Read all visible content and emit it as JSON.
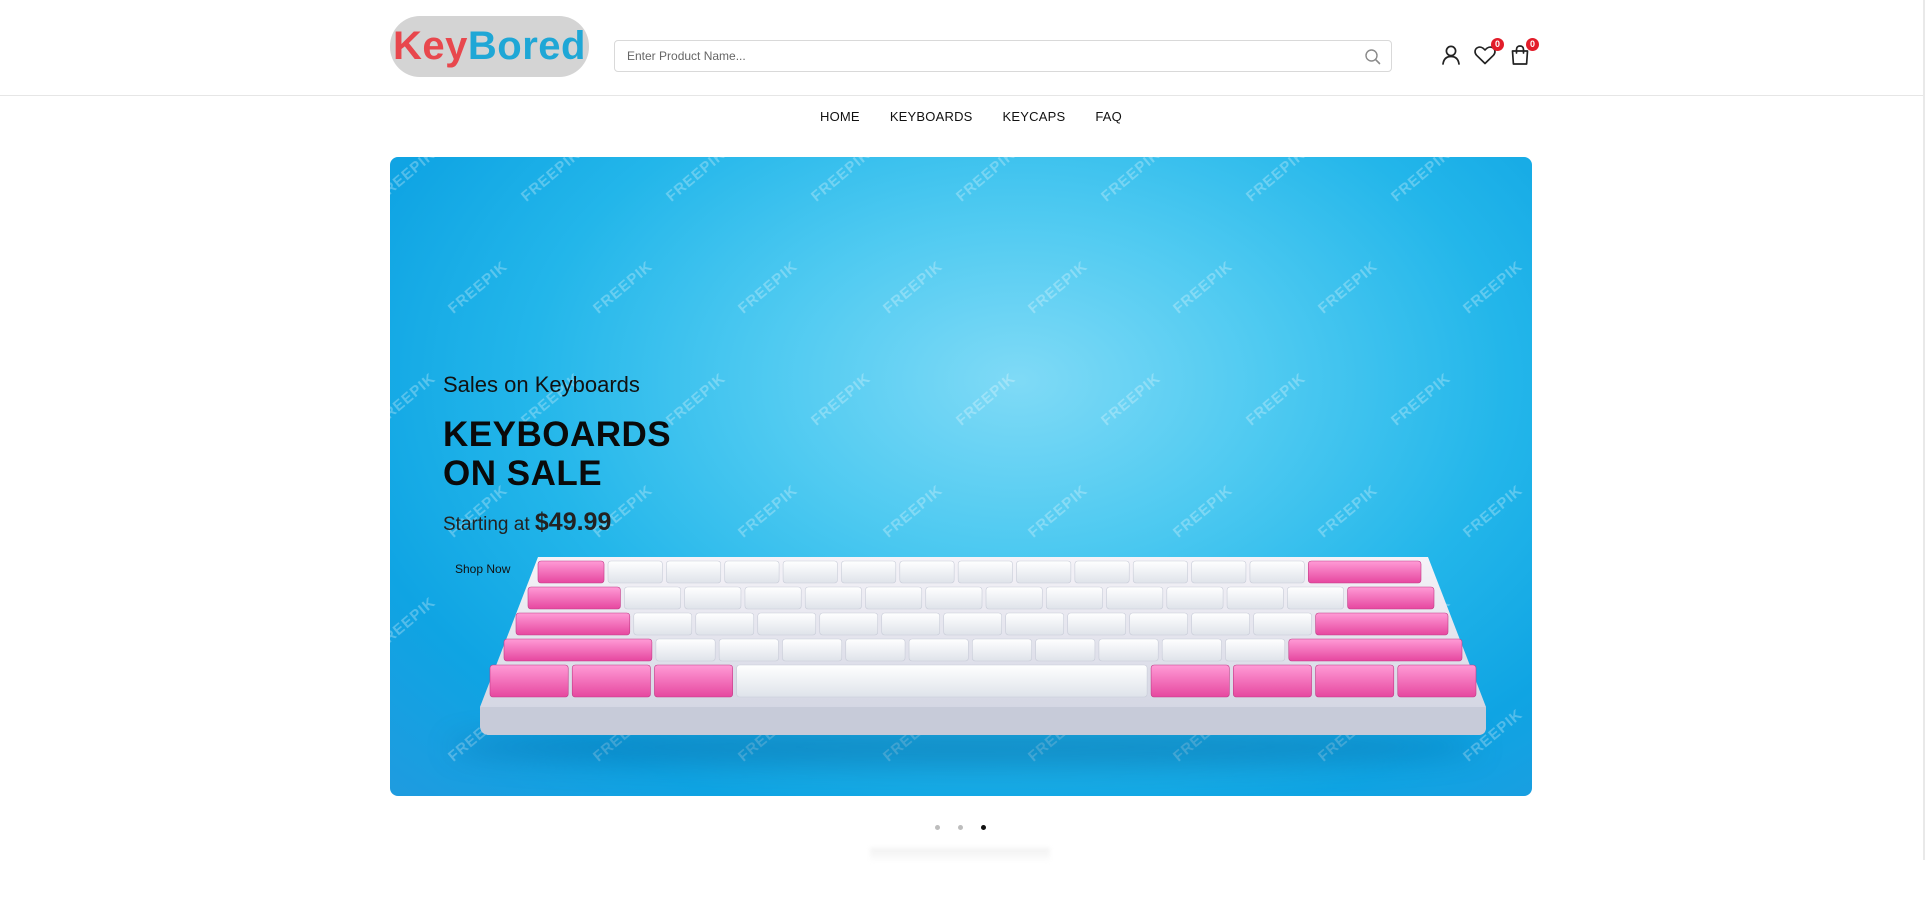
{
  "brand": {
    "part1": "Key",
    "part2": "Bored"
  },
  "search": {
    "placeholder": "Enter Product Name...",
    "value": ""
  },
  "header_icons": {
    "account": "user-icon",
    "wishlist": {
      "icon": "heart-icon",
      "count": "0"
    },
    "cart": {
      "icon": "shopping-bag-icon",
      "count": "0"
    }
  },
  "nav": {
    "items": [
      {
        "label": "HOME"
      },
      {
        "label": "KEYBOARDS"
      },
      {
        "label": "KEYCAPS"
      },
      {
        "label": "FAQ"
      }
    ]
  },
  "hero": {
    "subtitle": "Sales on Keyboards",
    "title_line1": "KEYBOARDS",
    "title_line2": "ON SALE",
    "price_prefix": "Starting at",
    "price": "$49.99",
    "cta": "Shop Now",
    "watermark": "FREEPIK"
  },
  "carousel": {
    "slides": 3,
    "active_index": 2
  },
  "colors": {
    "brand_red": "#e8474d",
    "brand_blue": "#1fa7d6",
    "badge": "#e21d2a",
    "hero_bg": "#23b6ea",
    "keycap_pink": "#f07cc4",
    "keycap_white": "#f4f4f4"
  }
}
